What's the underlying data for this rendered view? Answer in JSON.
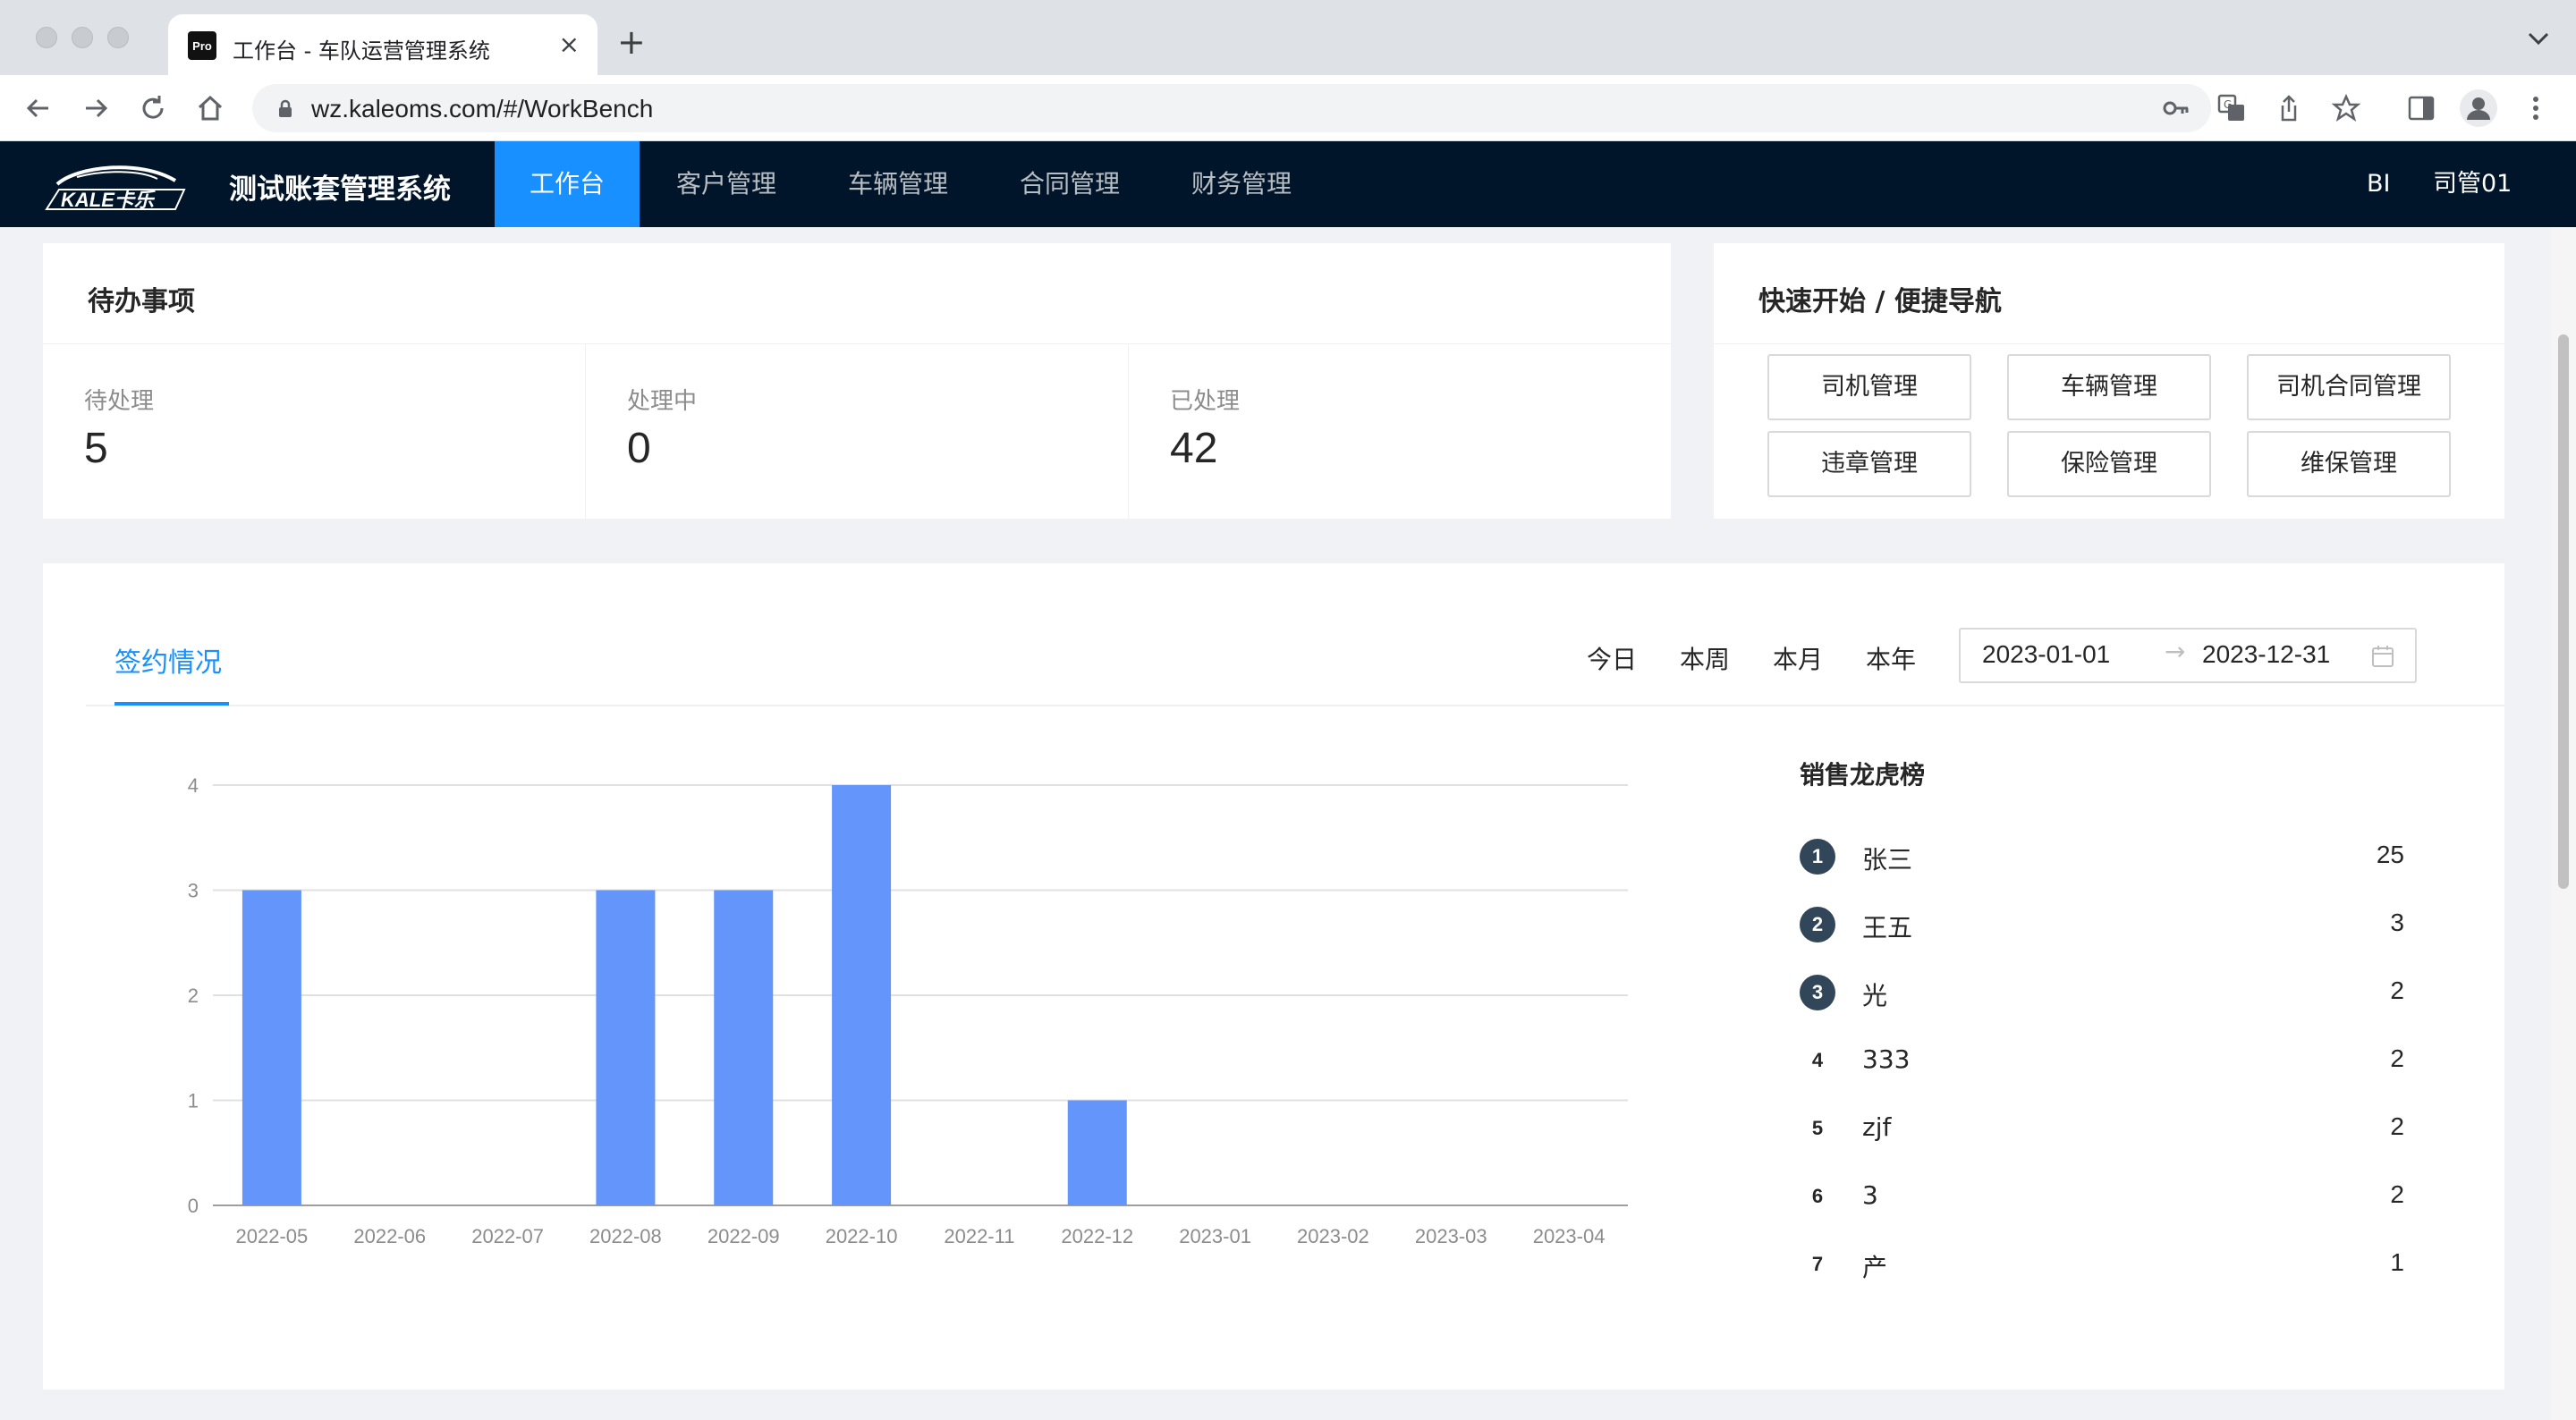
{
  "browser": {
    "tab_title": "工作台 - 车队运营管理系统",
    "favicon_text": "Pro",
    "url": "wz.kaleoms.com/#/WorkBench"
  },
  "appnav": {
    "logo_text": "KALE卡乐",
    "system_name": "测试账套管理系统",
    "menu": [
      "工作台",
      "客户管理",
      "车辆管理",
      "合同管理",
      "财务管理"
    ],
    "active_menu": "工作台",
    "bi": "BI",
    "user": "司管01"
  },
  "todo": {
    "title": "待办事项",
    "stats": [
      {
        "label": "待处理",
        "value": "5"
      },
      {
        "label": "处理中",
        "value": "0"
      },
      {
        "label": "已处理",
        "value": "42"
      }
    ]
  },
  "quick": {
    "title": "快速开始 / 便捷导航",
    "buttons": [
      "司机管理",
      "车辆管理",
      "司机合同管理",
      "违章管理",
      "保险管理",
      "维保管理"
    ]
  },
  "signing": {
    "tab": "签约情况",
    "ranges": [
      "今日",
      "本周",
      "本月",
      "本年"
    ],
    "date_start": "2023-01-01",
    "date_end": "2023-12-31"
  },
  "chart_data": {
    "type": "bar",
    "categories": [
      "2022-05",
      "2022-06",
      "2022-07",
      "2022-08",
      "2022-09",
      "2022-10",
      "2022-11",
      "2022-12",
      "2023-01",
      "2023-02",
      "2023-03",
      "2023-04"
    ],
    "values": [
      3,
      0,
      0,
      3,
      3,
      4,
      0,
      1,
      0,
      0,
      0,
      0
    ],
    "yticks": [
      0,
      1,
      2,
      3,
      4
    ],
    "ylim": [
      0,
      4
    ],
    "color": "#6395fa",
    "grid": true
  },
  "ranking": {
    "title": "销售龙虎榜",
    "rows": [
      {
        "rank": "1",
        "name": "张三",
        "score": "25"
      },
      {
        "rank": "2",
        "name": "王五",
        "score": "3"
      },
      {
        "rank": "3",
        "name": "光",
        "score": "2"
      },
      {
        "rank": "4",
        "name": "333",
        "score": "2"
      },
      {
        "rank": "5",
        "name": "zjf",
        "score": "2"
      },
      {
        "rank": "6",
        "name": "3",
        "score": "2"
      },
      {
        "rank": "7",
        "name": "产",
        "score": "1"
      }
    ]
  }
}
